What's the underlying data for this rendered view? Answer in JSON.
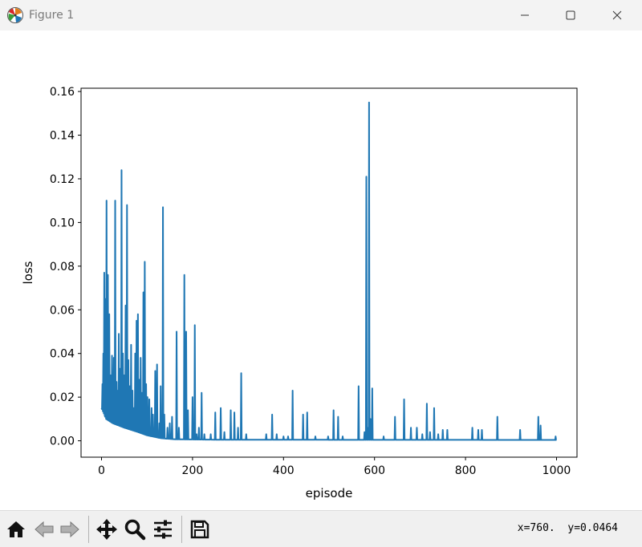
{
  "window": {
    "title": "Figure 1",
    "icon": "matplotlib-icon",
    "controls": [
      "minimize-icon",
      "maximize-icon",
      "close-icon"
    ]
  },
  "toolbar": {
    "buttons": [
      "home-icon",
      "back-arrow-icon",
      "forward-arrow-icon",
      "pan-move-icon",
      "zoom-magnifier-icon",
      "configure-subplots-icon",
      "save-floppy-icon"
    ],
    "coords_text": "x=760.  y=0.0464"
  },
  "chart_data": {
    "type": "line",
    "title": "",
    "xlabel": "episode",
    "ylabel": "loss",
    "xlim": [
      -45,
      1045
    ],
    "ylim": [
      -0.0075,
      0.1615
    ],
    "xticks": [
      0,
      200,
      400,
      600,
      800,
      1000
    ],
    "yticks": [
      0.0,
      0.02,
      0.04,
      0.06,
      0.08,
      0.1,
      0.12,
      0.14,
      0.16
    ],
    "xtick_labels": [
      "0",
      "200",
      "400",
      "600",
      "800",
      "1000"
    ],
    "ytick_labels": [
      "0.00",
      "0.02",
      "0.04",
      "0.06",
      "0.08",
      "0.10",
      "0.12",
      "0.14",
      "0.16"
    ],
    "grid": false,
    "line_color": "#1f77b4",
    "series": [
      {
        "name": "",
        "baseline": [
          [
            0,
            0.015
          ],
          [
            10,
            0.01
          ],
          [
            25,
            0.008
          ],
          [
            50,
            0.006
          ],
          [
            80,
            0.004
          ],
          [
            100,
            0.0025
          ],
          [
            130,
            0.0012
          ],
          [
            160,
            0.0007
          ],
          [
            250,
            0.0005
          ],
          [
            1000,
            0.0004
          ]
        ],
        "spikes": [
          [
            2,
            0.026
          ],
          [
            4,
            0.04
          ],
          [
            6,
            0.077
          ],
          [
            9,
            0.065
          ],
          [
            11,
            0.11
          ],
          [
            14,
            0.076
          ],
          [
            17,
            0.058
          ],
          [
            20,
            0.03
          ],
          [
            23,
            0.039
          ],
          [
            27,
            0.038
          ],
          [
            30,
            0.11
          ],
          [
            33,
            0.027
          ],
          [
            36,
            0.023
          ],
          [
            38,
            0.049
          ],
          [
            41,
            0.033
          ],
          [
            44,
            0.124
          ],
          [
            47,
            0.04
          ],
          [
            50,
            0.03
          ],
          [
            53,
            0.062
          ],
          [
            56,
            0.108
          ],
          [
            59,
            0.037
          ],
          [
            62,
            0.025
          ],
          [
            65,
            0.044
          ],
          [
            68,
            0.023
          ],
          [
            71,
            0.015
          ],
          [
            74,
            0.04
          ],
          [
            77,
            0.055
          ],
          [
            80,
            0.058
          ],
          [
            83,
            0.028
          ],
          [
            86,
            0.038
          ],
          [
            89,
            0.022
          ],
          [
            92,
            0.068
          ],
          [
            95,
            0.082
          ],
          [
            98,
            0.026
          ],
          [
            101,
            0.02
          ],
          [
            105,
            0.019
          ],
          [
            110,
            0.015
          ],
          [
            113,
            0.012
          ],
          [
            118,
            0.032
          ],
          [
            122,
            0.035
          ],
          [
            127,
            0.008
          ],
          [
            130,
            0.025
          ],
          [
            135,
            0.107
          ],
          [
            138,
            0.012
          ],
          [
            145,
            0.006
          ],
          [
            150,
            0.008
          ],
          [
            155,
            0.011
          ],
          [
            165,
            0.05
          ],
          [
            170,
            0.006
          ],
          [
            182,
            0.076
          ],
          [
            186,
            0.05
          ],
          [
            190,
            0.014
          ],
          [
            200,
            0.02
          ],
          [
            205,
            0.053
          ],
          [
            209,
            0.003
          ],
          [
            214,
            0.006
          ],
          [
            220,
            0.022
          ],
          [
            226,
            0.003
          ],
          [
            240,
            0.003
          ],
          [
            250,
            0.013
          ],
          [
            262,
            0.015
          ],
          [
            270,
            0.004
          ],
          [
            284,
            0.014
          ],
          [
            292,
            0.013
          ],
          [
            300,
            0.006
          ],
          [
            307,
            0.031
          ],
          [
            318,
            0.003
          ],
          [
            362,
            0.003
          ],
          [
            375,
            0.012
          ],
          [
            385,
            0.003
          ],
          [
            400,
            0.002
          ],
          [
            410,
            0.002
          ],
          [
            420,
            0.023
          ],
          [
            443,
            0.012
          ],
          [
            452,
            0.013
          ],
          [
            470,
            0.002
          ],
          [
            498,
            0.002
          ],
          [
            510,
            0.014
          ],
          [
            520,
            0.011
          ],
          [
            530,
            0.002
          ],
          [
            565,
            0.025
          ],
          [
            578,
            0.004
          ],
          [
            582,
            0.121
          ],
          [
            586,
            0.006
          ],
          [
            588,
            0.155
          ],
          [
            591,
            0.01
          ],
          [
            595,
            0.024
          ],
          [
            620,
            0.002
          ],
          [
            645,
            0.011
          ],
          [
            665,
            0.019
          ],
          [
            680,
            0.006
          ],
          [
            693,
            0.006
          ],
          [
            705,
            0.003
          ],
          [
            715,
            0.017
          ],
          [
            722,
            0.004
          ],
          [
            731,
            0.015
          ],
          [
            740,
            0.003
          ],
          [
            750,
            0.005
          ],
          [
            760,
            0.005
          ],
          [
            815,
            0.006
          ],
          [
            828,
            0.005
          ],
          [
            836,
            0.005
          ],
          [
            870,
            0.011
          ],
          [
            920,
            0.005
          ],
          [
            960,
            0.011
          ],
          [
            965,
            0.007
          ],
          [
            998,
            0.002
          ]
        ]
      }
    ]
  }
}
